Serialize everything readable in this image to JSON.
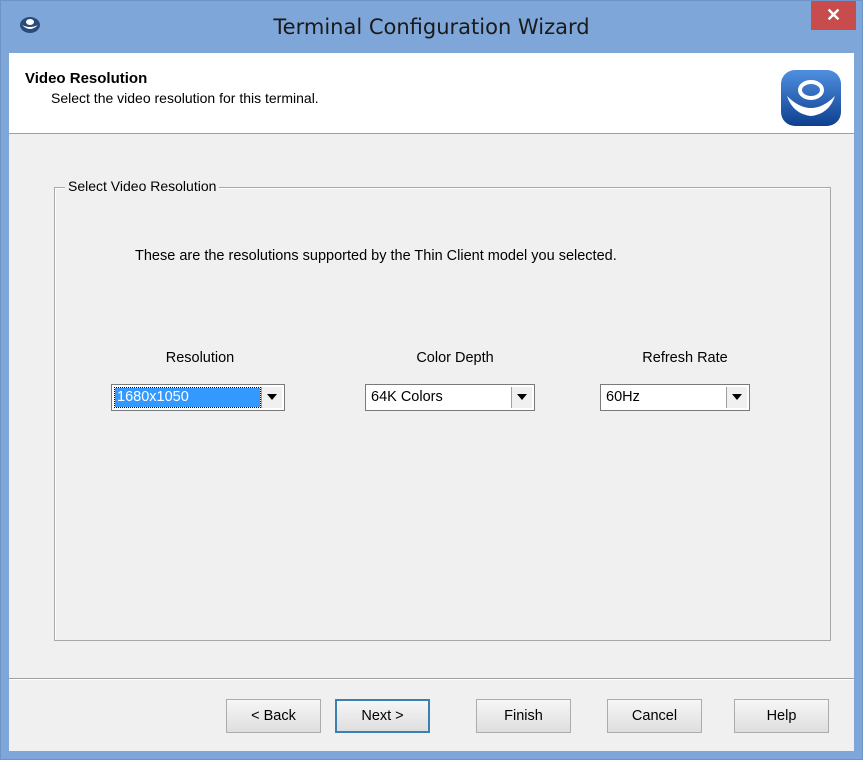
{
  "window": {
    "title": "Terminal Configuration Wizard",
    "close_glyph": "✕",
    "app_icon": "thintermserver-logo-icon"
  },
  "header": {
    "title": "Video Resolution",
    "subtitle": "Select the video resolution for this terminal.",
    "logo_icon": "thintermserver-logo-icon"
  },
  "group": {
    "legend": "Select Video Resolution",
    "description": "These are the resolutions supported by the Thin Client model you selected.",
    "resolution": {
      "label": "Resolution",
      "value": "1680x1050"
    },
    "color_depth": {
      "label": "Color Depth",
      "value": "64K Colors"
    },
    "refresh_rate": {
      "label": "Refresh Rate",
      "value": "60Hz"
    }
  },
  "buttons": {
    "back": "< Back",
    "next": "Next >",
    "finish": "Finish",
    "cancel": "Cancel",
    "help": "Help"
  },
  "colors": {
    "title_bar": "#7ea6d9",
    "close_button": "#c94c4c",
    "selection": "#3399ff"
  }
}
